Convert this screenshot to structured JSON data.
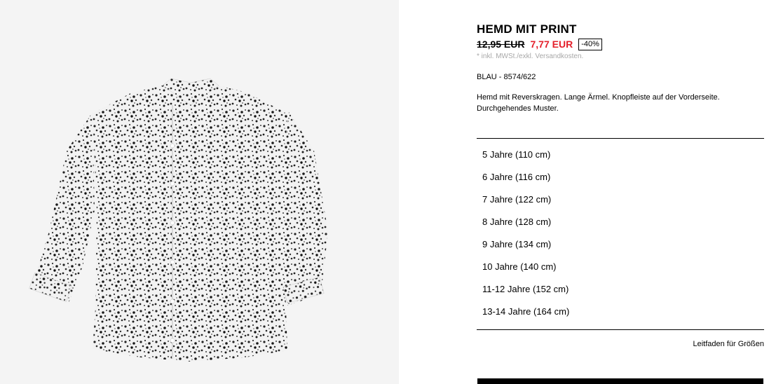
{
  "product": {
    "title": "HEMD MIT PRINT",
    "old_price": "12,95 EUR",
    "new_price": "7,77 EUR",
    "discount": "-40%",
    "tax_note": "* inkl. MWSt./exkl. Versandkosten.",
    "color_ref": "BLAU - 8574/622",
    "description": "Hemd mit Reverskragen. Lange Ärmel. Knopfleiste auf der Vorderseite. Durchgehendes Muster."
  },
  "sizes": [
    "5 Jahre (110 cm)",
    "6 Jahre (116 cm)",
    "7 Jahre (122 cm)",
    "8 Jahre (128 cm)",
    "9 Jahre (134 cm)",
    "10 Jahre (140 cm)",
    "11-12 Jahre (152 cm)",
    "13-14 Jahre (164 cm)"
  ],
  "size_guide_label": "Leitfaden für Größen",
  "colors": {
    "sale_red": "#e4202b",
    "image_background": "#f4f4f4",
    "tax_note_gray": "#a8a8a8"
  }
}
